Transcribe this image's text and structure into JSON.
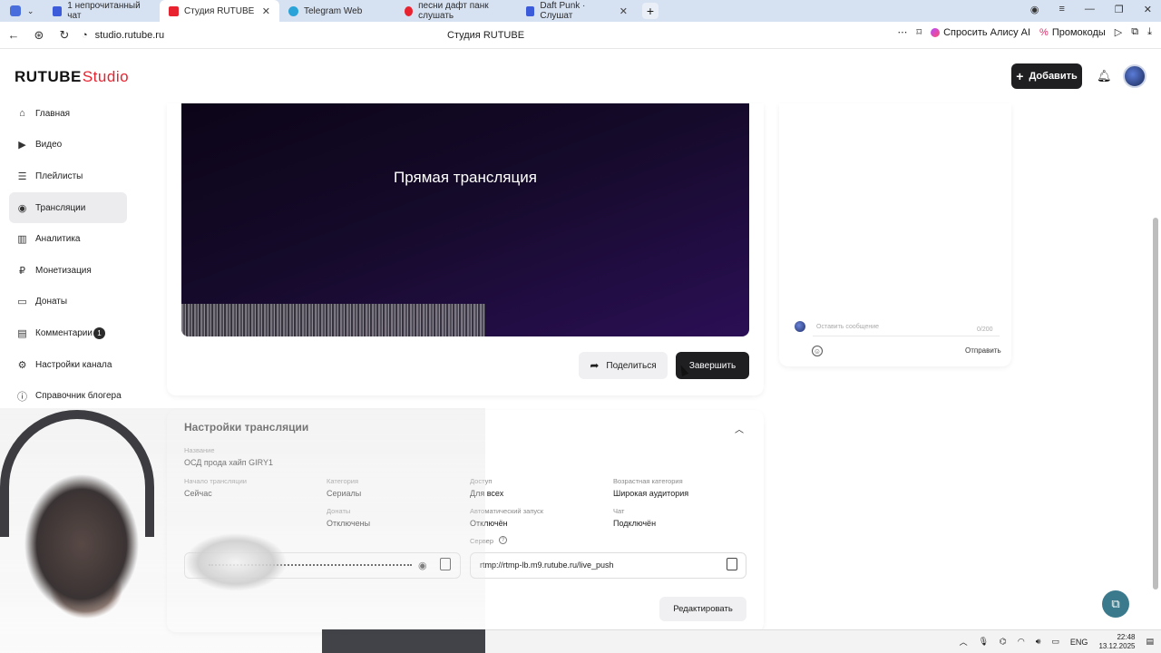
{
  "browser": {
    "tabs": [
      {
        "label": "1 непрочитанный чат",
        "color": "#3b5bdb"
      },
      {
        "label": "Студия RUTUBE",
        "color": "#e8222f",
        "active": true
      },
      {
        "label": "Telegram Web",
        "color": "#2aa3d8"
      },
      {
        "label": "песни дафт панк слушать",
        "color": "#e8222f"
      },
      {
        "label": "Daft Punk · Слушат",
        "color": "#3b5bdb"
      }
    ],
    "url": "studio.rutube.ru",
    "page_title": "Студия RUTUBE",
    "alice_label": "Спросить Алису AI",
    "promo_label": "Промокоды"
  },
  "header": {
    "logo_main": "RUTUBE",
    "logo_studio": "Studio",
    "add_label": "Добавить"
  },
  "sidebar": {
    "items": [
      {
        "label": "Главная",
        "icon": "home-icon"
      },
      {
        "label": "Видео",
        "icon": "video-icon"
      },
      {
        "label": "Плейлисты",
        "icon": "playlist-icon"
      },
      {
        "label": "Трансляции",
        "icon": "broadcast-icon",
        "active": true
      },
      {
        "label": "Аналитика",
        "icon": "analytics-icon"
      },
      {
        "label": "Монетизация",
        "icon": "monetization-icon"
      },
      {
        "label": "Донаты",
        "icon": "donate-icon"
      },
      {
        "label": "Комментарии",
        "icon": "comments-icon",
        "badge": "1"
      },
      {
        "label": "Настройки канала",
        "icon": "settings-icon"
      },
      {
        "label": "Справочник блогера",
        "icon": "info-icon"
      }
    ]
  },
  "player": {
    "title": "Прямая трансляция"
  },
  "actions": {
    "share_label": "Поделиться",
    "finish_label": "Завершить"
  },
  "chat": {
    "placeholder": "Оставить сообщение",
    "counter": "0/200",
    "send_label": "Отправить"
  },
  "settings": {
    "title": "Настройки трансляции",
    "name_label": "Название",
    "name_value": "ОСД прода хайп GIRY1",
    "start_label": "Начало трансляции",
    "start_value": "Сейчас",
    "category_label": "Категория",
    "category_value": "Сериалы",
    "access_label": "Доступ",
    "access_value": "Для всех",
    "age_label": "Возрастная категория",
    "age_value": "Широкая аудитория",
    "donates_label": "Донаты",
    "donates_value": "Отключены",
    "autostart_label": "Автоматический запуск",
    "autostart_value": "Отключён",
    "chat_label": "Чат",
    "chat_value": "Подключён",
    "server_label": "Сервер",
    "server_value": "rtmp://rtmp-lb.m9.rutube.ru/live_push",
    "edit_label": "Редактировать"
  },
  "taskbar": {
    "lang": "ENG",
    "time": "22:48",
    "date": "13.12.2025"
  }
}
